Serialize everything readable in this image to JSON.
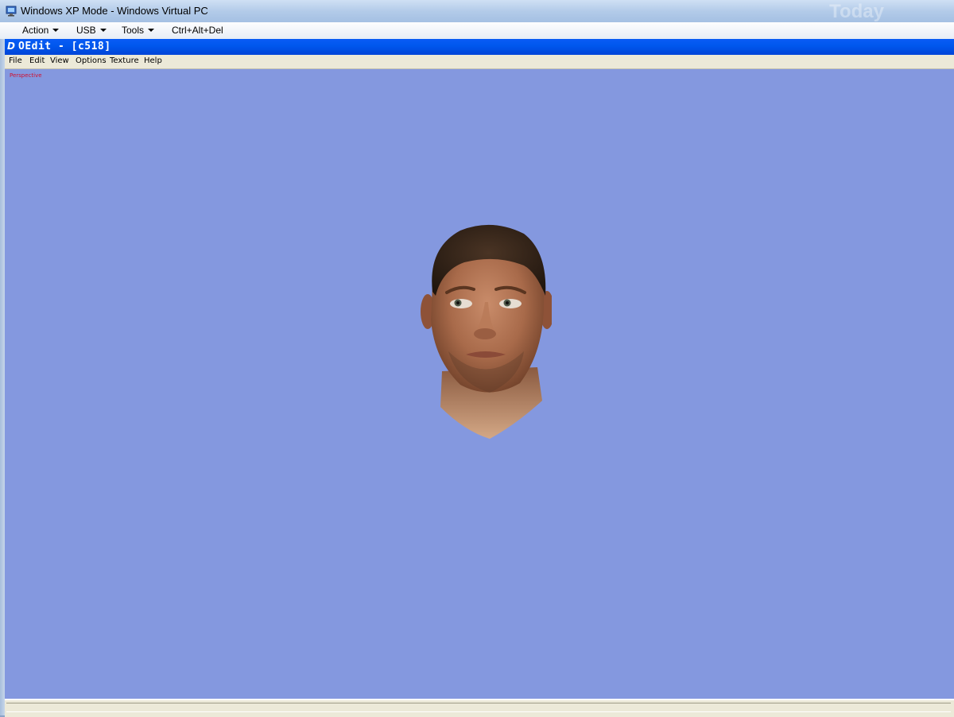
{
  "host": {
    "title": "Windows XP Mode - Windows Virtual PC",
    "watermark": "Today",
    "menu": [
      {
        "label": "Action"
      },
      {
        "label": "USB"
      },
      {
        "label": "Tools"
      },
      {
        "label": "Ctrl+Alt+Del"
      }
    ]
  },
  "app": {
    "icon_glyph": "D",
    "title": "OEdit - [c518]",
    "menu": [
      {
        "label": "File"
      },
      {
        "label": "Edit"
      },
      {
        "label": "View"
      },
      {
        "label": "Options"
      },
      {
        "label": "Texture"
      },
      {
        "label": "Help"
      }
    ]
  },
  "viewport": {
    "label": "Perspective",
    "background": "#8498df",
    "label_color": "#d01030"
  },
  "colors": {
    "xp_titlebar": "#0058ee",
    "host_titlebar": "#b3cbe9"
  }
}
